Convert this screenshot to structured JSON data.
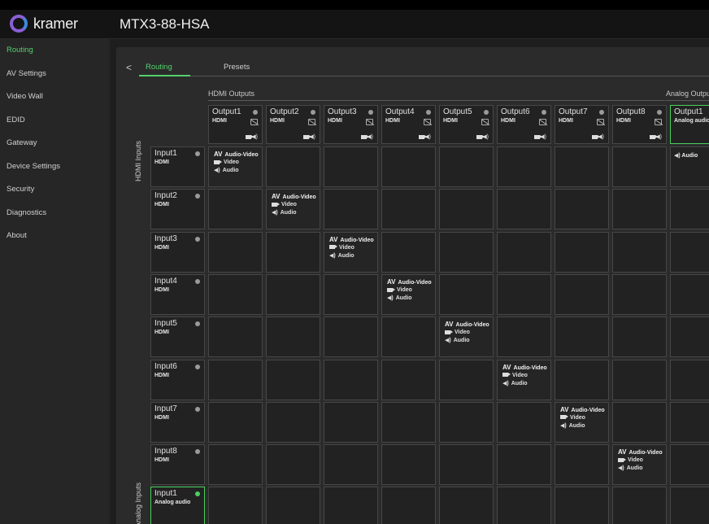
{
  "header": {
    "brand": "kramer",
    "device": "MTX3-88-HSA"
  },
  "sidebar": {
    "items": [
      {
        "label": "Routing",
        "active": true
      },
      {
        "label": "AV Settings"
      },
      {
        "label": "Video Wall"
      },
      {
        "label": "EDID"
      },
      {
        "label": "Gateway"
      },
      {
        "label": "Device Settings"
      },
      {
        "label": "Security"
      },
      {
        "label": "Diagnostics"
      },
      {
        "label": "About"
      }
    ]
  },
  "tabs": {
    "back": "<",
    "routing": "Routing",
    "presets": "Presets"
  },
  "groups": {
    "hdmi_outputs": "HDMI Outputs",
    "analog_outputs": "Analog Outputs",
    "hdmi_inputs": "HDMI Inputs",
    "analog_inputs": "Analog Inputs"
  },
  "outputs": [
    {
      "name": "Output1",
      "type": "HDMI"
    },
    {
      "name": "Output2",
      "type": "HDMI"
    },
    {
      "name": "Output3",
      "type": "HDMI"
    },
    {
      "name": "Output4",
      "type": "HDMI"
    },
    {
      "name": "Output5",
      "type": "HDMI"
    },
    {
      "name": "Output6",
      "type": "HDMI"
    },
    {
      "name": "Output7",
      "type": "HDMI"
    },
    {
      "name": "Output8",
      "type": "HDMI"
    }
  ],
  "analog_output": {
    "name": "Output1",
    "type": "Analog audio"
  },
  "inputs": [
    {
      "name": "Input1",
      "type": "HDMI"
    },
    {
      "name": "Input2",
      "type": "HDMI"
    },
    {
      "name": "Input3",
      "type": "HDMI"
    },
    {
      "name": "Input4",
      "type": "HDMI"
    },
    {
      "name": "Input5",
      "type": "HDMI"
    },
    {
      "name": "Input6",
      "type": "HDMI"
    },
    {
      "name": "Input7",
      "type": "HDMI"
    },
    {
      "name": "Input8",
      "type": "HDMI"
    }
  ],
  "analog_input": {
    "name": "Input1",
    "type": "Analog audio"
  },
  "route_labels": {
    "av_badge": "AV",
    "av": "Audio-Video",
    "video": "Video",
    "audio": "Audio"
  },
  "icons": {
    "video": "video-camera-icon",
    "audio": "speaker-icon",
    "no_signal": "no-signal-icon"
  },
  "colors": {
    "accent": "#55d06b",
    "status_on": "#4ad05e",
    "status_off": "#9a9a9a"
  }
}
